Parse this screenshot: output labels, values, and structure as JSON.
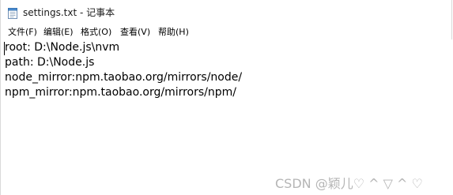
{
  "window": {
    "title": "settings.txt - 记事本"
  },
  "menu": {
    "items": [
      {
        "label": "文件(F)"
      },
      {
        "label": "编辑(E)"
      },
      {
        "label": "格式(O)"
      },
      {
        "label": "查看(V)"
      },
      {
        "label": "帮助(H)"
      }
    ]
  },
  "editor": {
    "lines": [
      "root: D:\\Node.js\\nvm",
      "path: D:\\Node.js",
      "node_mirror:npm.taobao.org/mirrors/node/",
      "npm_mirror:npm.taobao.org/mirrors/npm/"
    ]
  },
  "watermark": {
    "text": "CSDN @颖儿♡ ^ ▽ ^ ♡"
  }
}
